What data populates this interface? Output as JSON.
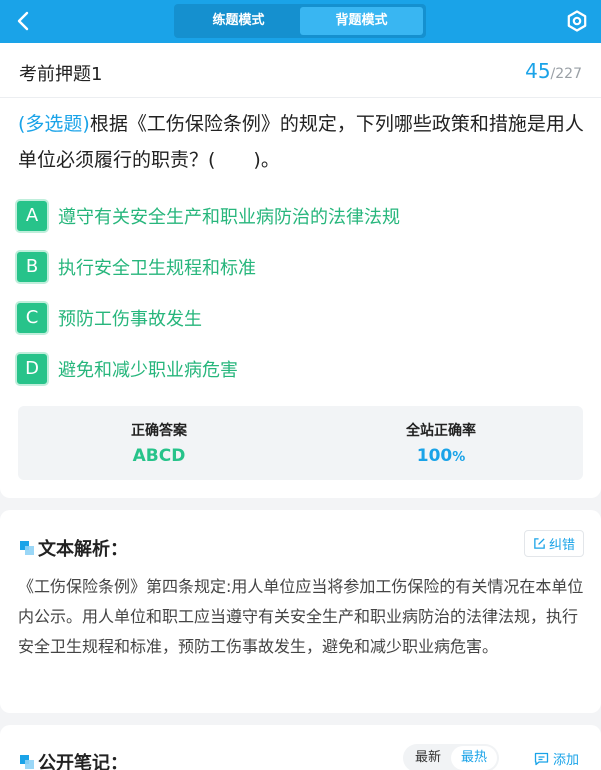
{
  "topbar": {
    "modes": [
      {
        "label": "练题模式",
        "active": false
      },
      {
        "label": "背题模式",
        "active": true
      }
    ],
    "icons": {
      "back": "chevron-left-icon",
      "settings": "gear-icon"
    },
    "color": "#1aa3e8"
  },
  "header": {
    "title": "考前押题1",
    "current": "45",
    "total": "/227"
  },
  "question": {
    "type_label": "(多选题)",
    "text": "根据《工伤保险条例》的规定，下列哪些政策和措施是用人单位必须履行的职责？(　　)。",
    "options": [
      {
        "letter": "A",
        "text": "遵守有关安全生产和职业病防治的法律法规"
      },
      {
        "letter": "B",
        "text": "执行安全卫生规程和标准"
      },
      {
        "letter": "C",
        "text": "预防工伤事故发生"
      },
      {
        "letter": "D",
        "text": "避免和减少职业病危害"
      }
    ]
  },
  "answer": {
    "correct_label": "正确答案",
    "correct_value": "ABCD",
    "rate_label": "全站正确率",
    "rate_value": "100",
    "rate_unit": "%"
  },
  "analysis": {
    "title": "文本解析：",
    "report_label": "纠错",
    "text": "《工伤保险条例》第四条规定:用人单位应当将参加工伤保险的有关情况在本单位内公示。用人单位和职工应当遵守有关安全生产和职业病防治的法律法规，执行安全卫生规程和标准，预防工伤事故发生，避免和减少职业病危害。"
  },
  "notes": {
    "title": "公开笔记：",
    "sort_options": [
      {
        "label": "最新",
        "active": false
      },
      {
        "label": "最热",
        "active": true
      }
    ],
    "add_label": "添加"
  }
}
